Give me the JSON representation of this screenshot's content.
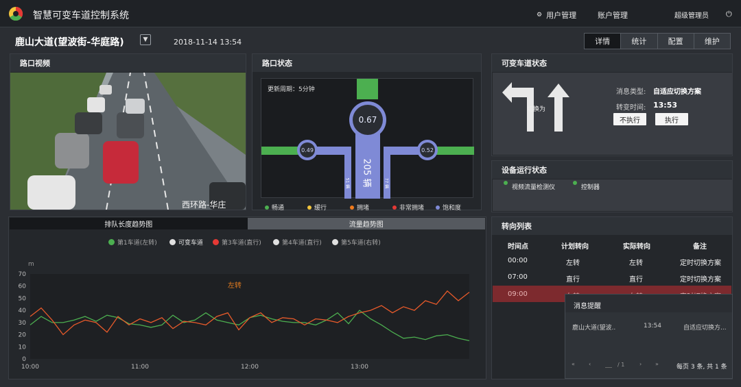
{
  "header": {
    "app_title": "智慧可变车道控制系统",
    "user_mgmt": "用户管理",
    "account_mgmt": "账户管理",
    "admin": "超级管理员"
  },
  "subheader": {
    "road": "鹿山大道(望波街-华庭路)",
    "datetime": "2018-11-14 13:54",
    "tabs": [
      "详情",
      "统计",
      "配置",
      "维护"
    ],
    "active_tab": 0
  },
  "video_panel": {
    "title": "路口视频",
    "overlay_text": "西环路-华庄"
  },
  "intersection": {
    "title": "路口状态",
    "update_cycle": "更新周期：5分钟",
    "center_value": "0.67",
    "left_value": "0.49",
    "right_value": "0.52",
    "vehicles": "205 辆",
    "left_lane_count": "51 辆",
    "right_lane_count": "77 辆",
    "legend": [
      {
        "label": "畅通",
        "color": "#4caf50"
      },
      {
        "label": "缓行",
        "color": "#f2c53d"
      },
      {
        "label": "拥堵",
        "color": "#f07b1c"
      },
      {
        "label": "非常拥堵",
        "color": "#e53935"
      },
      {
        "label": "饱和度",
        "color": "#7f8ad6"
      }
    ]
  },
  "lane_status": {
    "title": "可变车道状态",
    "switch_label": "切换为",
    "msg_type_label": "消息类型:",
    "msg_type_value": "自适应切换方案",
    "switch_time_label": "转变时间:",
    "switch_time_value": "13:53",
    "btn_reject": "不执行",
    "btn_execute": "执行"
  },
  "device_status": {
    "title": "设备运行状态",
    "items": [
      "视频流量检测仪",
      "控制器"
    ]
  },
  "turn_list": {
    "title": "转向列表",
    "headers": [
      "时间点",
      "计划转向",
      "实际转向",
      "备注"
    ],
    "rows": [
      [
        "00:00",
        "左转",
        "左转",
        "定时切换方案"
      ],
      [
        "07:00",
        "直行",
        "直行",
        "定时切换方案"
      ],
      [
        "09:00",
        "左转",
        "左转",
        "定时切换方案"
      ]
    ]
  },
  "message_popup": {
    "title": "消息提醒",
    "row": [
      "鹿山大道(望波..",
      "13:54",
      "自适应切换方..."
    ],
    "pager": "/ 1",
    "summary": "每页 3 条, 共 1 条"
  },
  "chart_tabs": [
    "排队长度趋势图",
    "流量趋势图"
  ],
  "chart_data": {
    "type": "line",
    "ylabel": "m",
    "ylim": [
      0,
      70
    ],
    "yticks": [
      0,
      10,
      20,
      30,
      40,
      50,
      60,
      70
    ],
    "xticks": [
      "10:00",
      "11:00",
      "12:00",
      "13:00"
    ],
    "annotation": "左转",
    "legend": [
      {
        "name": "第1车道(左转)",
        "color": "#4caf50",
        "active": false
      },
      {
        "name": "可变车道",
        "color": "#e0e0e0",
        "active": true
      },
      {
        "name": "第3车道(直行)",
        "color": "#e53935",
        "active": false
      },
      {
        "name": "第4车道(直行)",
        "color": "#e0e0e0",
        "active": false
      },
      {
        "name": "第5车道(右转)",
        "color": "#e0e0e0",
        "active": false
      }
    ],
    "x_range": [
      0,
      40
    ],
    "series": [
      {
        "name": "第1车道(左转)",
        "color": "#4caf50",
        "values": [
          28,
          35,
          30,
          30,
          32,
          35,
          31,
          36,
          34,
          29,
          28,
          26,
          28,
          36,
          30,
          32,
          38,
          32,
          30,
          28,
          34,
          36,
          33,
          31,
          30,
          30,
          28,
          32,
          38,
          29,
          40,
          33,
          28,
          22,
          17,
          18,
          16,
          19,
          20,
          17,
          15
        ]
      },
      {
        "name": "可变车道",
        "color": "#e85a2a",
        "values": [
          35,
          42,
          32,
          20,
          28,
          32,
          30,
          22,
          35,
          28,
          33,
          30,
          34,
          25,
          31,
          30,
          28,
          35,
          38,
          24,
          34,
          38,
          30,
          34,
          33,
          28,
          33,
          32,
          30,
          35,
          38,
          40,
          44,
          38,
          43,
          40,
          48,
          45,
          56,
          48,
          55
        ]
      }
    ]
  }
}
